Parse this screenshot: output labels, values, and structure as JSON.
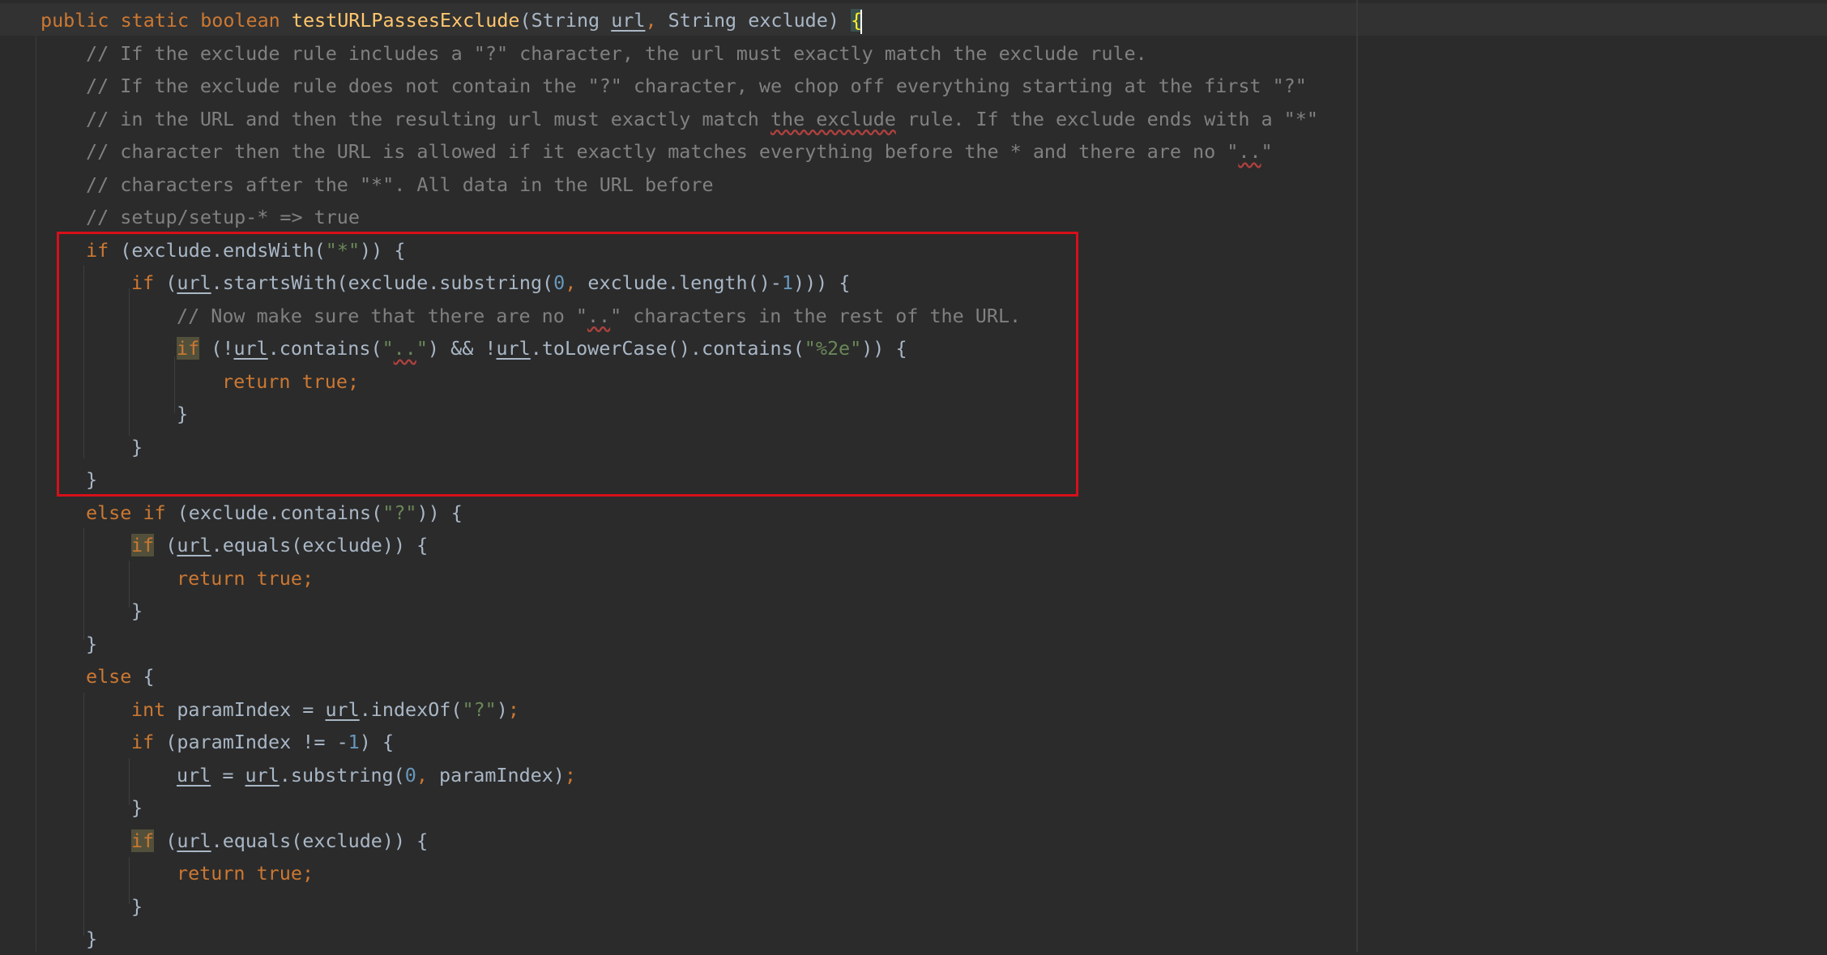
{
  "code": {
    "lines": [
      "public static boolean testURLPassesExclude(String url, String exclude) {",
      "// If the exclude rule includes a \"?\" character, the url must exactly match the exclude rule.",
      "// If the exclude rule does not contain the \"?\" character, we chop off everything starting at the first \"?\"",
      "// in the URL and then the resulting url must exactly match the exclude rule. If the exclude ends with a \"*\"",
      "// character then the URL is allowed if it exactly matches everything before the * and there are no \"..\"",
      "// characters after the \"*\". All data in the URL before",
      "// setup/setup-* => true",
      "if (exclude.endsWith(\"*\")) {",
      "if (url.startsWith(exclude.substring(0, exclude.length()-1))) {",
      "// Now make sure that there are no \"..\" characters in the rest of the URL.",
      "if (!url.contains(\"..\") && !url.toLowerCase().contains(\"%2e\")) {",
      "return true;",
      "}",
      "}",
      "}",
      "else if (exclude.contains(\"?\")) {",
      "if (url.equals(exclude)) {",
      "return true;",
      "}",
      "}",
      "else {",
      "int paramIndex = url.indexOf(\"?\");",
      "if (paramIndex != -1) {",
      "url = url.substring(0, paramIndex);",
      "}",
      "if (url.equals(exclude)) {",
      "return true;",
      "}",
      "}"
    ]
  },
  "annotation": {
    "highlight_color": "#d6101a"
  },
  "theme": {
    "background": "#2b2b2b",
    "keyword": "#cc7832",
    "function": "#ffc66d",
    "string": "#6a8759",
    "number": "#6897bb",
    "comment": "#808080",
    "plain": "#a9b7c6"
  }
}
